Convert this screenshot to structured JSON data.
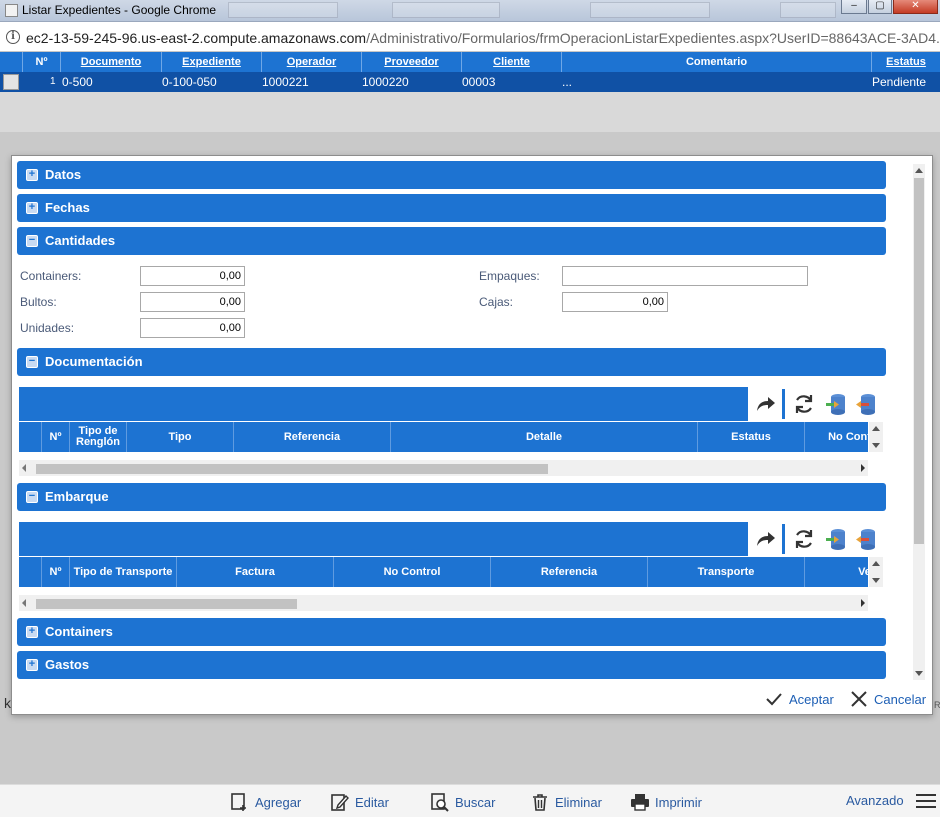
{
  "window": {
    "title": "Listar Expedientes - Google Chrome",
    "url_host": "ec2-13-59-245-96.us-east-2.compute.amazonaws.com",
    "url_path": "/Administrativo/Formularios/frmOperacionListarExpedientes.aspx?UserID=88643ACE-3AD4..."
  },
  "grid": {
    "headers": [
      "Nº",
      "Documento",
      "Expediente",
      "Operador",
      "Proveedor",
      "Cliente",
      "Comentario",
      "Estatus"
    ],
    "row": {
      "num": "1",
      "documento": "0-500",
      "expediente": "0-100-050",
      "operador": "1000221",
      "proveedor": "1000220",
      "cliente": "00003",
      "comentario": "...",
      "estatus": "Pendiente"
    }
  },
  "modal": {
    "sections": {
      "datos": "Datos",
      "fechas": "Fechas",
      "cantidades": "Cantidades",
      "documentacion": "Documentación",
      "embarque": "Embarque",
      "containers": "Containers",
      "gastos": "Gastos"
    },
    "cantidades": {
      "containers_label": "Containers:",
      "containers_value": "0,00",
      "bultos_label": "Bultos:",
      "bultos_value": "0,00",
      "unidades_label": "Unidades:",
      "unidades_value": "0,00",
      "empaques_label": "Empaques:",
      "empaques_value": "",
      "cajas_label": "Cajas:",
      "cajas_value": "0,00"
    },
    "documentacion_columns": [
      "Nº",
      "Tipo de Renglón",
      "Tipo",
      "Referencia",
      "Detalle",
      "Estatus",
      "No Cont"
    ],
    "embarque_columns": [
      "Nº",
      "Tipo de Transporte",
      "Factura",
      "No Control",
      "Referencia",
      "Transporte",
      "Ve"
    ],
    "accept_label": "Aceptar",
    "cancel_label": "Cancelar"
  },
  "toolbar": {
    "agregar": "Agregar",
    "editar": "Editar",
    "buscar": "Buscar",
    "eliminar": "Eliminar",
    "imprimir": "Imprimir",
    "avanzado": "Avanzado"
  },
  "colors": {
    "accent": "#1d73d2",
    "selected_row": "#1051a5"
  }
}
